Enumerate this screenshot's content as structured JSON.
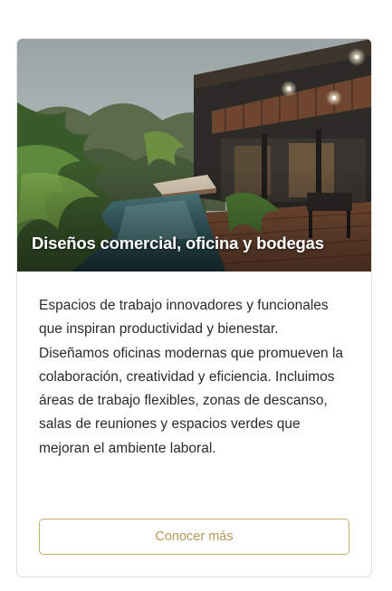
{
  "card": {
    "title": "Diseños comercial, oficina y bodegas",
    "description": "Espacios de trabajo innovadores y funcionales que inspiran productividad y bienestar. Diseñamos oficinas modernas que promueven la colaboración, creatividad y eficiencia. Incluimos áreas de trabajo flexibles, zonas de descanso, salas de reuniones y espacios verdes que mejoran el ambiente laboral.",
    "button_label": "Conocer más",
    "image_subject": "modern-house-pool-render"
  },
  "colors": {
    "accent": "#c9ad73",
    "accent_text": "#b89656",
    "text": "#2b2b2b",
    "border": "#e3e3e3"
  }
}
